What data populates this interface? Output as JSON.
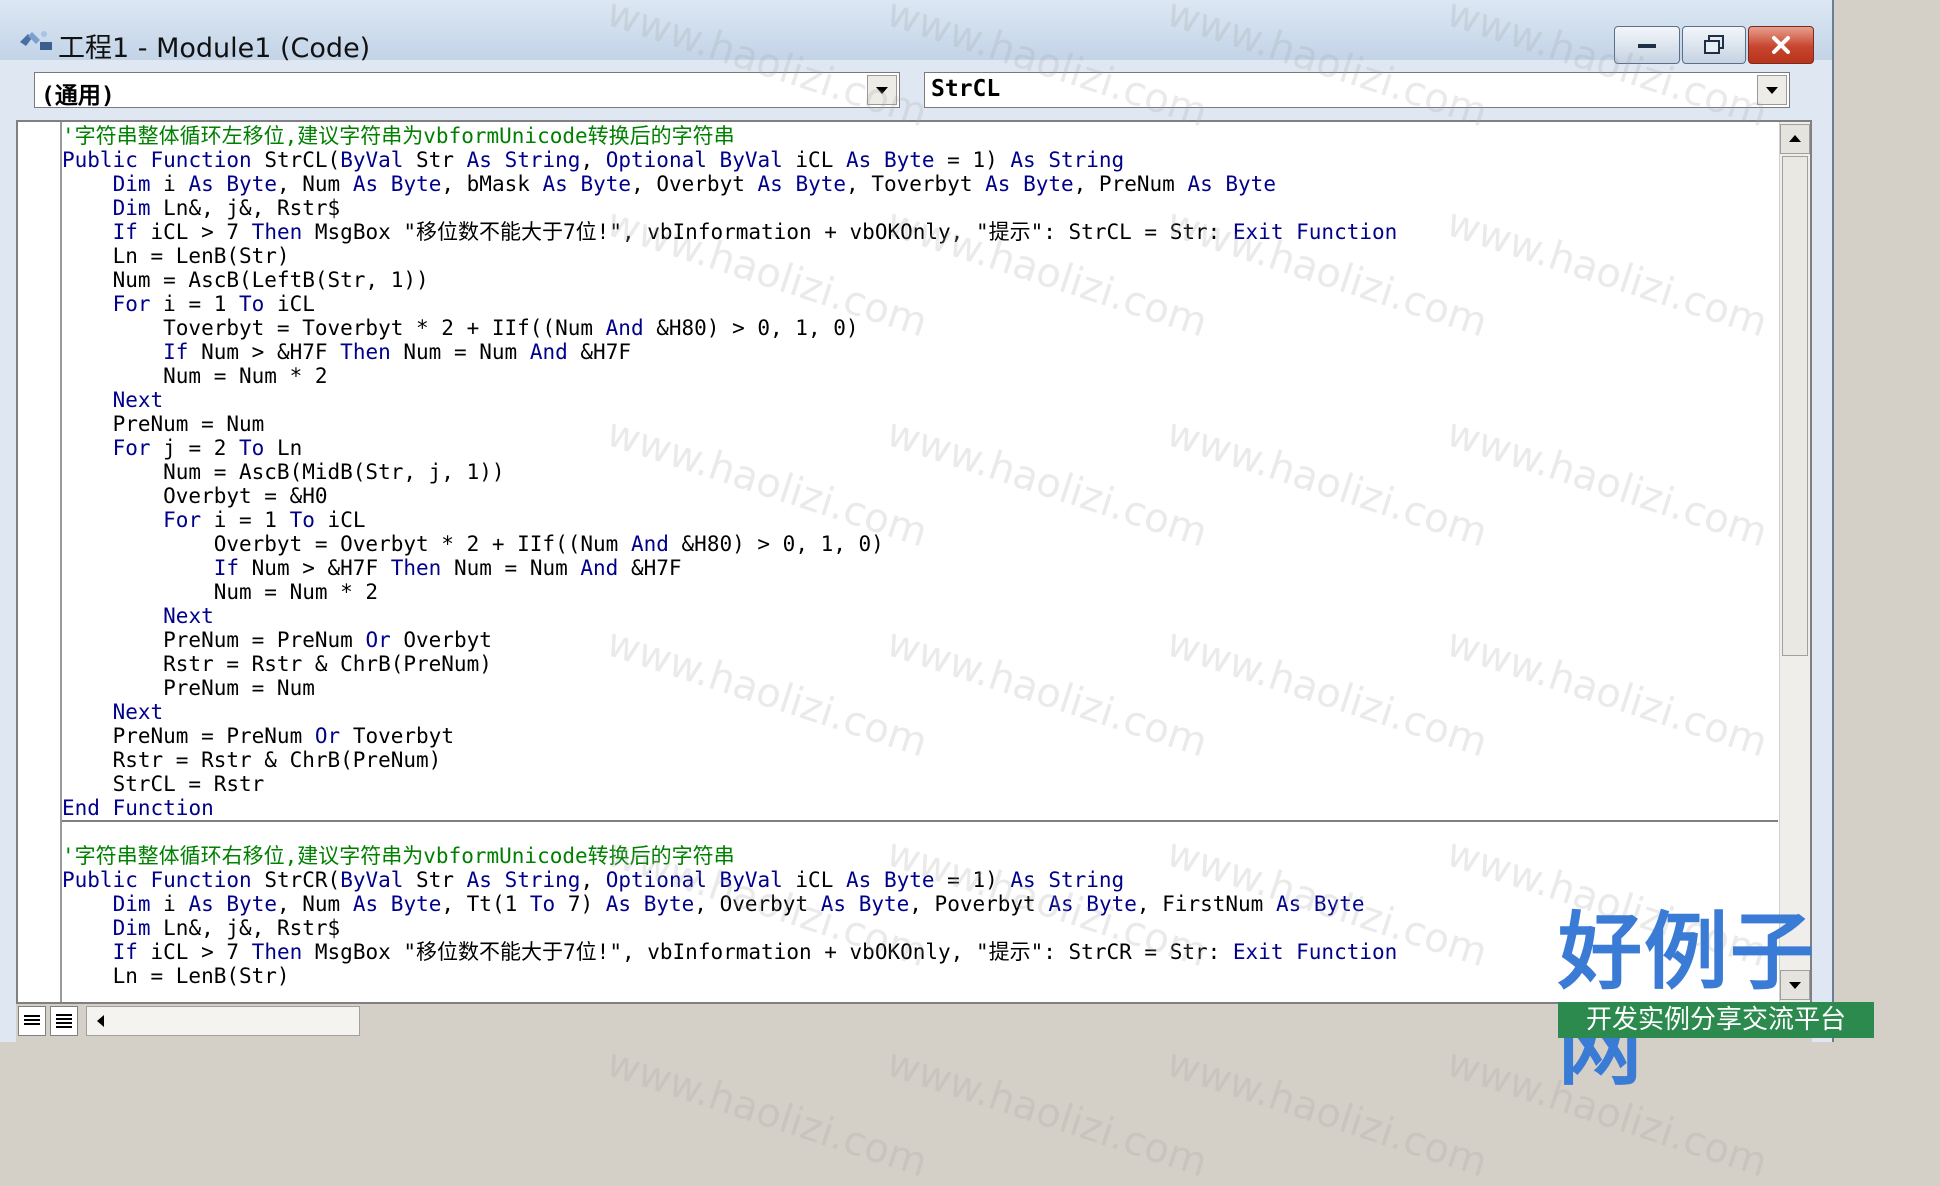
{
  "window": {
    "title": "工程1 - Module1 (Code)",
    "buttons": {
      "minimize": "minimize",
      "maximize": "maximize",
      "close": "close"
    }
  },
  "toolbar": {
    "object_combo": "(通用)",
    "procedure_combo": "StrCL"
  },
  "colors": {
    "keyword": "#00008b",
    "comment": "#008000",
    "text": "#000000",
    "title_bar": "#c9d7e8",
    "close_button": "#c7452e"
  },
  "code": {
    "procedures": [
      {
        "lines": [
          "'字符串整体循环左移位,建议字符串为vbformUnicode转换后的字符串",
          "Public Function StrCL(ByVal Str As String, Optional ByVal iCL As Byte = 1) As String",
          "    Dim i As Byte, Num As Byte, bMask As Byte, Overbyt As Byte, Toverbyt As Byte, PreNum As Byte",
          "    Dim Ln&, j&, Rstr$",
          "    If iCL > 7 Then MsgBox \"移位数不能大于7位!\", vbInformation + vbOKOnly, \"提示\": StrCL = Str: Exit Function",
          "    Ln = LenB(Str)",
          "    Num = AscB(LeftB(Str, 1))",
          "    For i = 1 To iCL",
          "        Toverbyt = Toverbyt * 2 + IIf((Num And &H80) > 0, 1, 0)",
          "        If Num > &H7F Then Num = Num And &H7F",
          "        Num = Num * 2",
          "    Next",
          "    PreNum = Num",
          "    For j = 2 To Ln",
          "        Num = AscB(MidB(Str, j, 1))",
          "        Overbyt = &H0",
          "        For i = 1 To iCL",
          "            Overbyt = Overbyt * 2 + IIf((Num And &H80) > 0, 1, 0)",
          "            If Num > &H7F Then Num = Num And &H7F",
          "            Num = Num * 2",
          "        Next",
          "        PreNum = PreNum Or Overbyt",
          "        Rstr = Rstr & ChrB(PreNum)",
          "        PreNum = Num",
          "    Next",
          "    PreNum = PreNum Or Toverbyt",
          "    Rstr = Rstr & ChrB(PreNum)",
          "    StrCL = Rstr",
          "End Function"
        ]
      },
      {
        "lines": [
          "'字符串整体循环右移位,建议字符串为vbformUnicode转换后的字符串",
          "Public Function StrCR(ByVal Str As String, Optional ByVal iCL As Byte = 1) As String",
          "    Dim i As Byte, Num As Byte, Tt(1 To 7) As Byte, Overbyt As Byte, Poverbyt As Byte, FirstNum As Byte",
          "    Dim Ln&, j&, Rstr$",
          "    If iCL > 7 Then MsgBox \"移位数不能大于7位!\", vbInformation + vbOKOnly, \"提示\": StrCR = Str: Exit Function",
          "    Ln = LenB(Str)"
        ]
      }
    ]
  },
  "watermark": {
    "text": "www.haolizi.com"
  },
  "logo": {
    "main": "好例子网",
    "sub": "开发实例分享交流平台"
  }
}
